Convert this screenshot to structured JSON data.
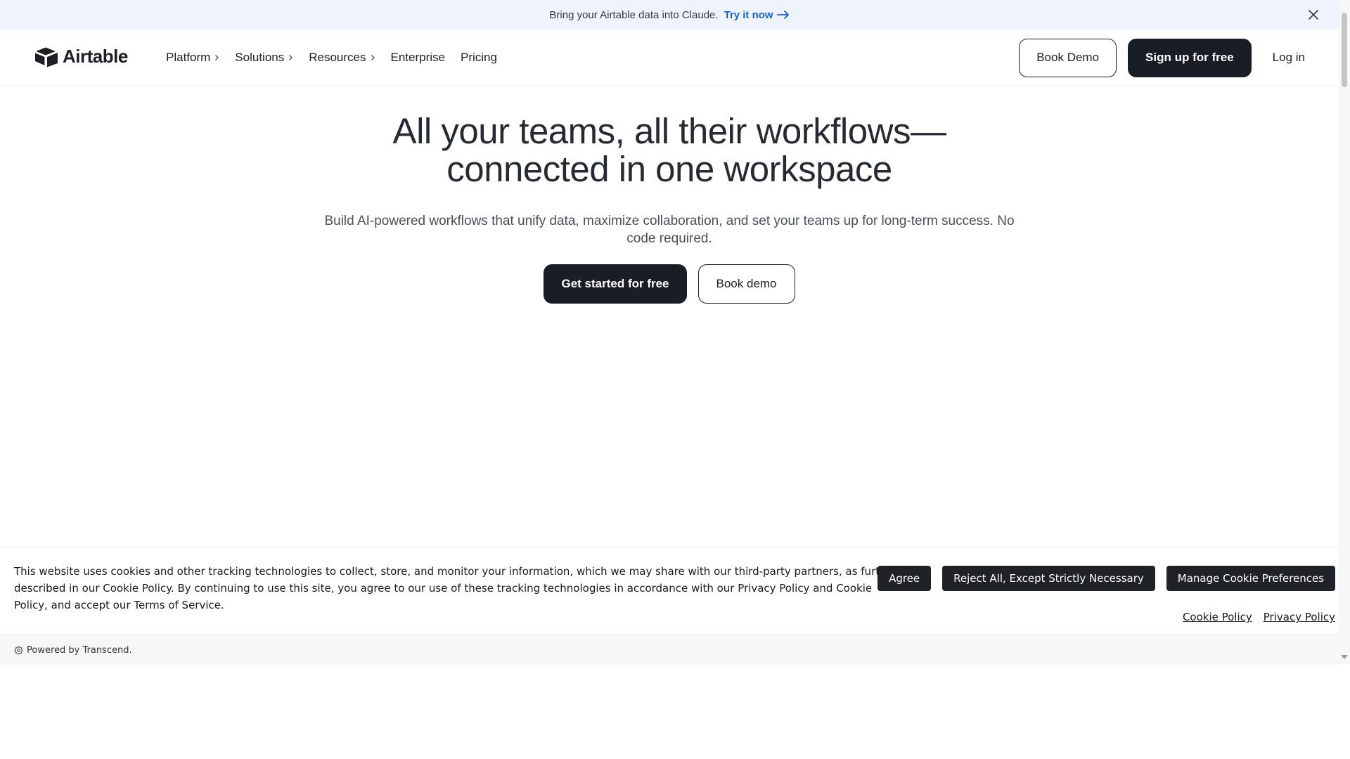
{
  "announcement": {
    "text": "Bring your Airtable data into Claude.",
    "link_label": "Try it now",
    "close_icon": "close-icon"
  },
  "header": {
    "logo_text": "Airtable",
    "nav": [
      {
        "label": "Platform",
        "has_chevron": true
      },
      {
        "label": "Solutions",
        "has_chevron": true
      },
      {
        "label": "Resources",
        "has_chevron": true
      },
      {
        "label": "Enterprise",
        "has_chevron": false
      },
      {
        "label": "Pricing",
        "has_chevron": false
      }
    ],
    "book_demo_label": "Book Demo",
    "signup_label": "Sign up for free",
    "login_label": "Log in"
  },
  "hero": {
    "title_line1": "All your teams, all their workflows—",
    "title_line2": "connected in one workspace",
    "subtitle": "Build AI-powered workflows that unify data, maximize collaboration, and set your teams up for long-term success. No code required.",
    "primary_cta": "Get started for free",
    "secondary_cta": "Book demo"
  },
  "cookie_banner": {
    "text": "This website uses cookies and other tracking technologies to collect, store, and monitor your information, which we may share with our third-party partners, as further described in our Cookie Policy. By continuing to use this site, you agree to our use of these tracking technologies in accordance with our Privacy Policy and Cookie Policy, and accept our Terms of Service.",
    "agree_label": "Agree",
    "reject_label": "Reject All, Except Strictly Necessary",
    "manage_label": "Manage Cookie Preferences",
    "cookie_policy_link": "Cookie Policy",
    "privacy_policy_link": "Privacy Policy",
    "powered_by": "Powered by Transcend."
  },
  "colors": {
    "announce_bg": "#eef3fc",
    "link_blue": "#1b61c9",
    "dark_button": "#181d26",
    "cookie_button": "#1f2227"
  }
}
